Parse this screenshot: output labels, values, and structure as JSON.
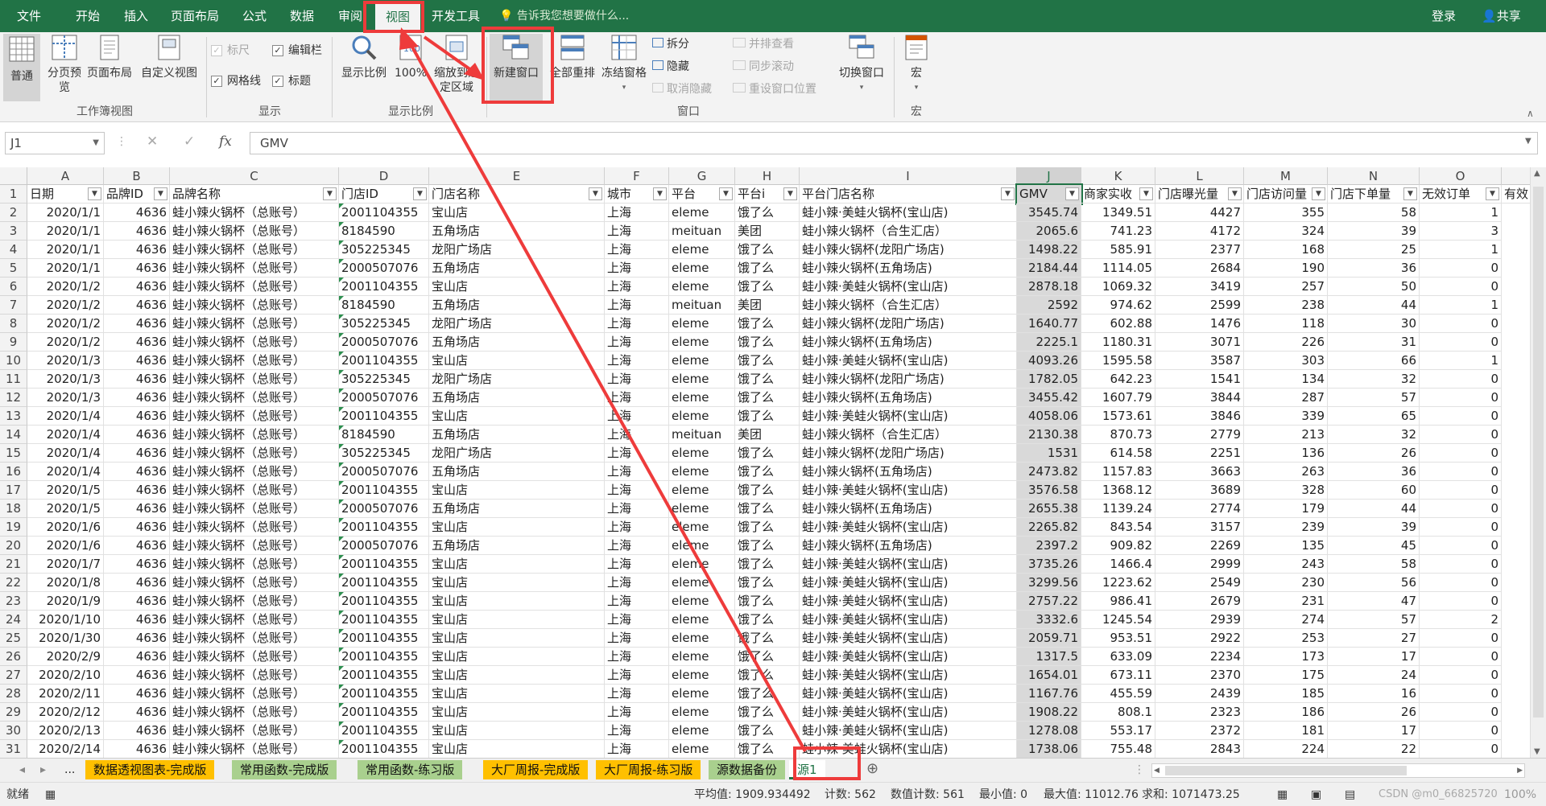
{
  "tabs": [
    "文件",
    "开始",
    "插入",
    "页面布局",
    "公式",
    "数据",
    "审阅",
    "视图",
    "开发工具"
  ],
  "active_tab": "视图",
  "tell_me": "告诉我您想要做什么...",
  "login": "登录",
  "share": "共享",
  "ribbon": {
    "workbook_views": {
      "normal": "普通",
      "page_break": "分页预览",
      "page_layout": "页面布局",
      "custom": "自定义视图",
      "group": "工作簿视图"
    },
    "show": {
      "ruler": "标尺",
      "formula_bar": "编辑栏",
      "gridlines": "网格线",
      "headings": "标题",
      "group": "显示"
    },
    "zoom": {
      "zoom": "显示比例",
      "zoom100": "100%",
      "zoom_sel": "缩放到选定区域",
      "group": "显示比例"
    },
    "window": {
      "new_window": "新建窗口",
      "arrange_all": "全部重排",
      "freeze": "冻结窗格",
      "split": "拆分",
      "hide": "隐藏",
      "unhide": "取消隐藏",
      "side_by_side": "并排查看",
      "sync_scroll": "同步滚动",
      "reset_pos": "重设窗口位置",
      "switch": "切换窗口",
      "group": "窗口"
    },
    "macros": {
      "macros": "宏",
      "group": "宏"
    }
  },
  "formula_bar": {
    "namebox": "J1",
    "cancel": "✕",
    "enter": "✓",
    "fx": "fx",
    "value": "GMV"
  },
  "columns": [
    "A",
    "B",
    "C",
    "D",
    "E",
    "F",
    "G",
    "H",
    "I",
    "J",
    "K",
    "L",
    "M",
    "N",
    "O"
  ],
  "headers": [
    "日期",
    "品牌ID",
    "品牌名称",
    "门店ID",
    "门店名称",
    "城市",
    "平台",
    "平台i",
    "平台门店名称",
    "GMV",
    "商家实收",
    "门店曝光量",
    "门店访问量",
    "门店下单量",
    "无效订单",
    "有效"
  ],
  "rows": [
    [
      "2020/1/1",
      "4636",
      "蛙小辣火锅杯（总账号）",
      "2001104355",
      "宝山店",
      "上海",
      "eleme",
      "饿了么",
      "蛙小辣·美蛙火锅杯(宝山店)",
      "3545.74",
      "1349.51",
      "4427",
      "355",
      "58",
      "1"
    ],
    [
      "2020/1/1",
      "4636",
      "蛙小辣火锅杯（总账号）",
      "8184590",
      "五角场店",
      "上海",
      "meituan",
      "美团",
      "蛙小辣火锅杯（合生汇店）",
      "2065.6",
      "741.23",
      "4172",
      "324",
      "39",
      "3"
    ],
    [
      "2020/1/1",
      "4636",
      "蛙小辣火锅杯（总账号）",
      "305225345",
      "龙阳广场店",
      "上海",
      "eleme",
      "饿了么",
      "蛙小辣火锅杯(龙阳广场店)",
      "1498.22",
      "585.91",
      "2377",
      "168",
      "25",
      "1"
    ],
    [
      "2020/1/1",
      "4636",
      "蛙小辣火锅杯（总账号）",
      "2000507076",
      "五角场店",
      "上海",
      "eleme",
      "饿了么",
      "蛙小辣火锅杯(五角场店)",
      "2184.44",
      "1114.05",
      "2684",
      "190",
      "36",
      "0"
    ],
    [
      "2020/1/2",
      "4636",
      "蛙小辣火锅杯（总账号）",
      "2001104355",
      "宝山店",
      "上海",
      "eleme",
      "饿了么",
      "蛙小辣·美蛙火锅杯(宝山店)",
      "2878.18",
      "1069.32",
      "3419",
      "257",
      "50",
      "0"
    ],
    [
      "2020/1/2",
      "4636",
      "蛙小辣火锅杯（总账号）",
      "8184590",
      "五角场店",
      "上海",
      "meituan",
      "美团",
      "蛙小辣火锅杯（合生汇店）",
      "2592",
      "974.62",
      "2599",
      "238",
      "44",
      "1"
    ],
    [
      "2020/1/2",
      "4636",
      "蛙小辣火锅杯（总账号）",
      "305225345",
      "龙阳广场店",
      "上海",
      "eleme",
      "饿了么",
      "蛙小辣火锅杯(龙阳广场店)",
      "1640.77",
      "602.88",
      "1476",
      "118",
      "30",
      "0"
    ],
    [
      "2020/1/2",
      "4636",
      "蛙小辣火锅杯（总账号）",
      "2000507076",
      "五角场店",
      "上海",
      "eleme",
      "饿了么",
      "蛙小辣火锅杯(五角场店)",
      "2225.1",
      "1180.31",
      "3071",
      "226",
      "31",
      "0"
    ],
    [
      "2020/1/3",
      "4636",
      "蛙小辣火锅杯（总账号）",
      "2001104355",
      "宝山店",
      "上海",
      "eleme",
      "饿了么",
      "蛙小辣·美蛙火锅杯(宝山店)",
      "4093.26",
      "1595.58",
      "3587",
      "303",
      "66",
      "1"
    ],
    [
      "2020/1/3",
      "4636",
      "蛙小辣火锅杯（总账号）",
      "305225345",
      "龙阳广场店",
      "上海",
      "eleme",
      "饿了么",
      "蛙小辣火锅杯(龙阳广场店)",
      "1782.05",
      "642.23",
      "1541",
      "134",
      "32",
      "0"
    ],
    [
      "2020/1/3",
      "4636",
      "蛙小辣火锅杯（总账号）",
      "2000507076",
      "五角场店",
      "上海",
      "eleme",
      "饿了么",
      "蛙小辣火锅杯(五角场店)",
      "3455.42",
      "1607.79",
      "3844",
      "287",
      "57",
      "0"
    ],
    [
      "2020/1/4",
      "4636",
      "蛙小辣火锅杯（总账号）",
      "2001104355",
      "宝山店",
      "上海",
      "eleme",
      "饿了么",
      "蛙小辣·美蛙火锅杯(宝山店)",
      "4058.06",
      "1573.61",
      "3846",
      "339",
      "65",
      "0"
    ],
    [
      "2020/1/4",
      "4636",
      "蛙小辣火锅杯（总账号）",
      "8184590",
      "五角场店",
      "上海",
      "meituan",
      "美团",
      "蛙小辣火锅杯（合生汇店）",
      "2130.38",
      "870.73",
      "2779",
      "213",
      "32",
      "0"
    ],
    [
      "2020/1/4",
      "4636",
      "蛙小辣火锅杯（总账号）",
      "305225345",
      "龙阳广场店",
      "上海",
      "eleme",
      "饿了么",
      "蛙小辣火锅杯(龙阳广场店)",
      "1531",
      "614.58",
      "2251",
      "136",
      "26",
      "0"
    ],
    [
      "2020/1/4",
      "4636",
      "蛙小辣火锅杯（总账号）",
      "2000507076",
      "五角场店",
      "上海",
      "eleme",
      "饿了么",
      "蛙小辣火锅杯(五角场店)",
      "2473.82",
      "1157.83",
      "3663",
      "263",
      "36",
      "0"
    ],
    [
      "2020/1/5",
      "4636",
      "蛙小辣火锅杯（总账号）",
      "2001104355",
      "宝山店",
      "上海",
      "eleme",
      "饿了么",
      "蛙小辣·美蛙火锅杯(宝山店)",
      "3576.58",
      "1368.12",
      "3689",
      "328",
      "60",
      "0"
    ],
    [
      "2020/1/5",
      "4636",
      "蛙小辣火锅杯（总账号）",
      "2000507076",
      "五角场店",
      "上海",
      "eleme",
      "饿了么",
      "蛙小辣火锅杯(五角场店)",
      "2655.38",
      "1139.24",
      "2774",
      "179",
      "44",
      "0"
    ],
    [
      "2020/1/6",
      "4636",
      "蛙小辣火锅杯（总账号）",
      "2001104355",
      "宝山店",
      "上海",
      "eleme",
      "饿了么",
      "蛙小辣·美蛙火锅杯(宝山店)",
      "2265.82",
      "843.54",
      "3157",
      "239",
      "39",
      "0"
    ],
    [
      "2020/1/6",
      "4636",
      "蛙小辣火锅杯（总账号）",
      "2000507076",
      "五角场店",
      "上海",
      "eleme",
      "饿了么",
      "蛙小辣火锅杯(五角场店)",
      "2397.2",
      "909.82",
      "2269",
      "135",
      "45",
      "0"
    ],
    [
      "2020/1/7",
      "4636",
      "蛙小辣火锅杯（总账号）",
      "2001104355",
      "宝山店",
      "上海",
      "eleme",
      "饿了么",
      "蛙小辣·美蛙火锅杯(宝山店)",
      "3735.26",
      "1466.4",
      "2999",
      "243",
      "58",
      "0"
    ],
    [
      "2020/1/8",
      "4636",
      "蛙小辣火锅杯（总账号）",
      "2001104355",
      "宝山店",
      "上海",
      "eleme",
      "饿了么",
      "蛙小辣·美蛙火锅杯(宝山店)",
      "3299.56",
      "1223.62",
      "2549",
      "230",
      "56",
      "0"
    ],
    [
      "2020/1/9",
      "4636",
      "蛙小辣火锅杯（总账号）",
      "2001104355",
      "宝山店",
      "上海",
      "eleme",
      "饿了么",
      "蛙小辣·美蛙火锅杯(宝山店)",
      "2757.22",
      "986.41",
      "2679",
      "231",
      "47",
      "0"
    ],
    [
      "2020/1/10",
      "4636",
      "蛙小辣火锅杯（总账号）",
      "2001104355",
      "宝山店",
      "上海",
      "eleme",
      "饿了么",
      "蛙小辣·美蛙火锅杯(宝山店)",
      "3332.6",
      "1245.54",
      "2939",
      "274",
      "57",
      "2"
    ],
    [
      "2020/1/30",
      "4636",
      "蛙小辣火锅杯（总账号）",
      "2001104355",
      "宝山店",
      "上海",
      "eleme",
      "饿了么",
      "蛙小辣·美蛙火锅杯(宝山店)",
      "2059.71",
      "953.51",
      "2922",
      "253",
      "27",
      "0"
    ],
    [
      "2020/2/9",
      "4636",
      "蛙小辣火锅杯（总账号）",
      "2001104355",
      "宝山店",
      "上海",
      "eleme",
      "饿了么",
      "蛙小辣·美蛙火锅杯(宝山店)",
      "1317.5",
      "633.09",
      "2234",
      "173",
      "17",
      "0"
    ],
    [
      "2020/2/10",
      "4636",
      "蛙小辣火锅杯（总账号）",
      "2001104355",
      "宝山店",
      "上海",
      "eleme",
      "饿了么",
      "蛙小辣·美蛙火锅杯(宝山店)",
      "1654.01",
      "673.11",
      "2370",
      "175",
      "24",
      "0"
    ],
    [
      "2020/2/11",
      "4636",
      "蛙小辣火锅杯（总账号）",
      "2001104355",
      "宝山店",
      "上海",
      "eleme",
      "饿了么",
      "蛙小辣·美蛙火锅杯(宝山店)",
      "1167.76",
      "455.59",
      "2439",
      "185",
      "16",
      "0"
    ],
    [
      "2020/2/12",
      "4636",
      "蛙小辣火锅杯（总账号）",
      "2001104355",
      "宝山店",
      "上海",
      "eleme",
      "饿了么",
      "蛙小辣·美蛙火锅杯(宝山店)",
      "1908.22",
      "808.1",
      "2323",
      "186",
      "26",
      "0"
    ],
    [
      "2020/2/13",
      "4636",
      "蛙小辣火锅杯（总账号）",
      "2001104355",
      "宝山店",
      "上海",
      "eleme",
      "饿了么",
      "蛙小辣·美蛙火锅杯(宝山店)",
      "1278.08",
      "553.17",
      "2372",
      "181",
      "17",
      "0"
    ],
    [
      "2020/2/14",
      "4636",
      "蛙小辣火锅杯（总账号）",
      "2001104355",
      "宝山店",
      "上海",
      "eleme",
      "饿了么",
      "蛙小辣·美蛙火锅杯(宝山店)",
      "1738.06",
      "755.48",
      "2843",
      "224",
      "22",
      "0"
    ]
  ],
  "sheets": [
    {
      "name": "数据透视图表-完成版",
      "color": "#ffc000"
    },
    {
      "name": "常用函数-完成版",
      "color": "#a9d08e"
    },
    {
      "name": "常用函数-练习版",
      "color": "#a9d08e"
    },
    {
      "name": "大厂周报-完成版",
      "color": "#ffc000"
    },
    {
      "name": "大厂周报-练习版",
      "color": "#ffc000"
    },
    {
      "name": "源数据备份",
      "color": "#a9d08e"
    },
    {
      "name": "源1",
      "color": "#ffffff"
    }
  ],
  "active_sheet": "源1",
  "sheet_nav": {
    "prev": "◂",
    "next": "▸",
    "more": "..."
  },
  "status": {
    "ready": "就绪",
    "average": "平均值: 1909.934492",
    "count": "计数: 562",
    "numeric_count": "数值计数: 561",
    "min": "最小值: 0",
    "max": "最大值: 11012.76",
    "sum": "求和: 1071473.25",
    "zoom": "100%",
    "watermark": "CSDN @m0_66825720"
  },
  "colors": {
    "excel_green": "#217346",
    "annotation_red": "#ee3b3b",
    "selected_col": "#d9d9d9"
  }
}
